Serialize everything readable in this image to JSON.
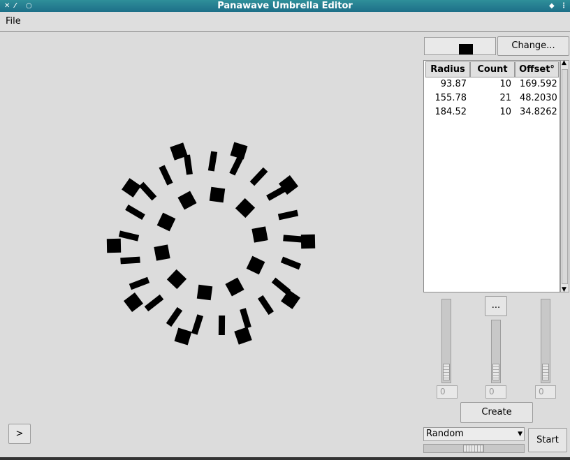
{
  "window": {
    "title": "Panawave Umbrella Editor"
  },
  "menu": {
    "file": "File"
  },
  "controls": {
    "change_label": "Change...",
    "ellipsis_label": "...",
    "create_label": "Create",
    "start_label": "Start",
    "toggle_label": ">",
    "mode_selected": "Random",
    "spin_values": [
      "0",
      "0",
      "0"
    ],
    "swatch_color": "#000000"
  },
  "table": {
    "headers": [
      "Radius",
      "Count",
      "Offset°"
    ],
    "rows": [
      [
        "93.87",
        "10",
        "169.5924"
      ],
      [
        "155.78",
        "21",
        "48.20308"
      ],
      [
        "184.52",
        "10",
        "34.82628"
      ]
    ]
  }
}
